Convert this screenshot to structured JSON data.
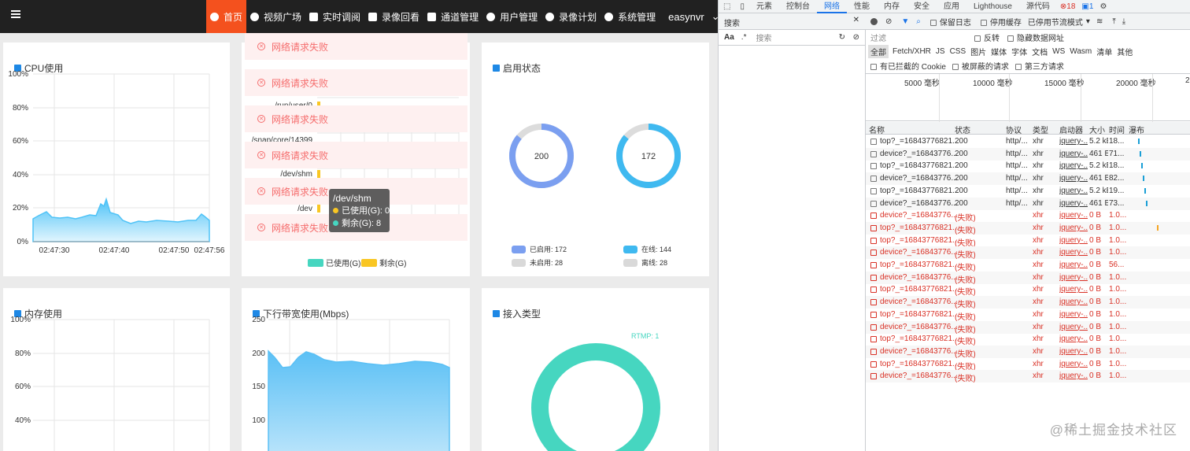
{
  "app": {
    "nav": [
      "首页",
      "视频广场",
      "实时调阅",
      "录像回看",
      "通道管理",
      "用户管理",
      "录像计划",
      "系统管理"
    ],
    "user": "easynvr"
  },
  "cpu": {
    "title": "CPU使用",
    "yticks": [
      "100%",
      "80%",
      "60%",
      "40%",
      "20%",
      "0%"
    ],
    "xticks": [
      "02:47:30",
      "02:47:40",
      "02:47:50",
      "02:47:56"
    ]
  },
  "disk": {
    "ylabels": [
      "/run/user/0",
      "/snap/core/14399",
      "/dev/shm",
      "/dev"
    ],
    "legend": [
      "已使用(G)",
      "剩余(G)"
    ],
    "tooltip": {
      "title": "/dev/shm",
      "used": "已使用(G): 0",
      "free": "剩余(G): 8"
    }
  },
  "errors": [
    "网络请求失败",
    "网络请求失败",
    "网络请求失败",
    "网络请求失败",
    "网络请求失败",
    "网络请求失败"
  ],
  "status": {
    "title": "启用状态",
    "left_value": "200",
    "right_value": "172",
    "legend": [
      {
        "label": "已启用",
        "value": "172",
        "color": "#7b9ff0"
      },
      {
        "label": "在线",
        "value": "144",
        "color": "#3fb9f0"
      },
      {
        "label": "未启用",
        "value": "28",
        "color": "#d9d9d9"
      },
      {
        "label": "离线",
        "value": "28",
        "color": "#d9d9d9"
      }
    ]
  },
  "memory": {
    "title": "内存使用",
    "yticks": [
      "100%",
      "80%",
      "60%",
      "40%"
    ]
  },
  "bandwidth": {
    "title": "下行带宽使用(Mbps)",
    "yticks": [
      "250",
      "200",
      "150",
      "100"
    ]
  },
  "access": {
    "title": "接入类型",
    "label": "RTMP: 1"
  },
  "devtools": {
    "tabs": [
      "元素",
      "控制台",
      "网络",
      "性能",
      "内存",
      "安全",
      "应用",
      "Lighthouse",
      "源代码"
    ],
    "badges": [
      "18",
      "1"
    ],
    "search_title": "搜索",
    "search_placeholder": "搜索",
    "case": "Aa",
    "regex": ".*",
    "toolbar": {
      "preserve": "保留日志",
      "cache": "停用缓存",
      "throttle": "已停用节流模式"
    },
    "filter": {
      "placeholder": "过滤",
      "invert": "反转",
      "hide_data": "隐藏数据网址"
    },
    "types": [
      "全部",
      "Fetch/XHR",
      "JS",
      "CSS",
      "图片",
      "媒体",
      "字体",
      "文档",
      "WS",
      "Wasm",
      "清单",
      "其他"
    ],
    "blocked": [
      "有已拦截的 Cookie",
      "被屏蔽的请求",
      "第三方请求"
    ],
    "timeline": [
      "5000 毫秒",
      "10000 毫秒",
      "15000 毫秒",
      "20000 毫秒",
      "2"
    ],
    "columns": [
      "名称",
      "状态",
      "协议",
      "类型",
      "启动器",
      "大小",
      "时间",
      "瀑布"
    ],
    "rows": [
      [
        "top?_=16843776821...",
        "200",
        "http/...",
        "xhr",
        "jquery-...",
        "5.2 kB",
        "18..."
      ],
      [
        "device?_=16843776...",
        "200",
        "http/...",
        "xhr",
        "jquery-...",
        "461 B",
        "71..."
      ],
      [
        "top?_=16843776821...",
        "200",
        "http/...",
        "xhr",
        "jquery-...",
        "5.2 kB",
        "18..."
      ],
      [
        "device?_=16843776...",
        "200",
        "http/...",
        "xhr",
        "jquery-...",
        "461 B",
        "82..."
      ],
      [
        "top?_=16843776821...",
        "200",
        "http/...",
        "xhr",
        "jquery-...",
        "5.2 kB",
        "19..."
      ],
      [
        "device?_=16843776...",
        "200",
        "http/...",
        "xhr",
        "jquery-...",
        "461 B",
        "73..."
      ],
      [
        "device?_=16843776...",
        "(失败)",
        "",
        "xhr",
        "jquery-...",
        "0 B",
        "1.0..."
      ],
      [
        "top?_=16843776821...",
        "(失败)",
        "",
        "xhr",
        "jquery-...",
        "0 B",
        "1.0..."
      ],
      [
        "top?_=16843776821...",
        "(失败)",
        "",
        "xhr",
        "jquery-...",
        "0 B",
        "1.0..."
      ],
      [
        "device?_=16843776...",
        "(失败)",
        "",
        "xhr",
        "jquery-...",
        "0 B",
        "1.0..."
      ],
      [
        "top?_=16843776821...",
        "(失败)",
        "",
        "xhr",
        "jquery-...",
        "0 B",
        "56..."
      ],
      [
        "device?_=16843776...",
        "(失败)",
        "",
        "xhr",
        "jquery-...",
        "0 B",
        "1.0..."
      ],
      [
        "top?_=16843776821...",
        "(失败)",
        "",
        "xhr",
        "jquery-...",
        "0 B",
        "1.0..."
      ],
      [
        "device?_=16843776...",
        "(失败)",
        "",
        "xhr",
        "jquery-...",
        "0 B",
        "1.0..."
      ],
      [
        "top?_=16843776821...",
        "(失败)",
        "",
        "xhr",
        "jquery-...",
        "0 B",
        "1.0..."
      ],
      [
        "device?_=16843776...",
        "(失败)",
        "",
        "xhr",
        "jquery-...",
        "0 B",
        "1.0..."
      ],
      [
        "top?_=16843776821...",
        "(失败)",
        "",
        "xhr",
        "jquery-...",
        "0 B",
        "1.0..."
      ],
      [
        "device?_=16843776...",
        "(失败)",
        "",
        "xhr",
        "jquery-...",
        "0 B",
        "1.0..."
      ],
      [
        "top?_=16843776821...",
        "(失败)",
        "",
        "xhr",
        "jquery-...",
        "0 B",
        "1.0..."
      ],
      [
        "device?_=16843776...",
        "(失败)",
        "",
        "xhr",
        "jquery-...",
        "0 B",
        "1.0..."
      ]
    ]
  },
  "watermark": "@稀土掘金技术社区"
}
